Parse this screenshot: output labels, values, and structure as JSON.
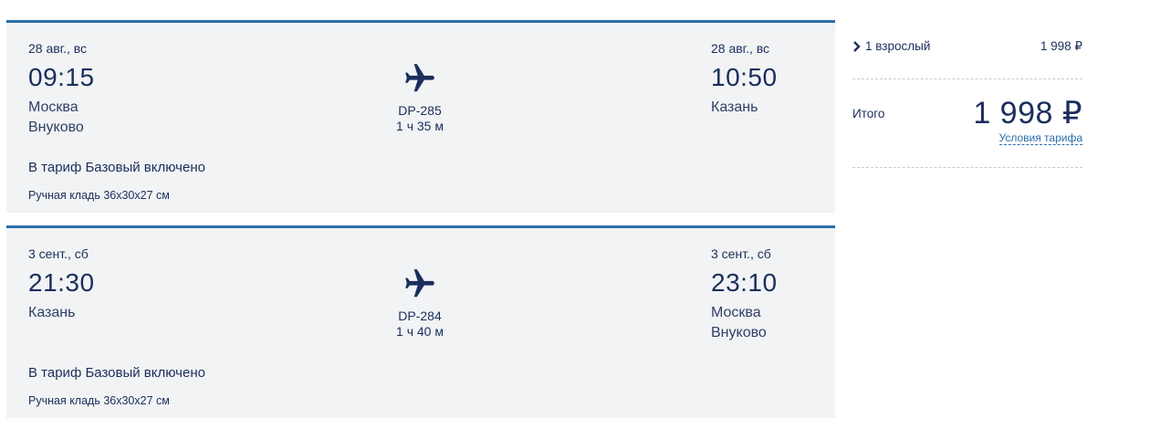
{
  "flights": [
    {
      "departure": {
        "date": "28 авг., вс",
        "time": "09:15",
        "city": "Москва",
        "airport": "Внуково"
      },
      "arrival": {
        "date": "28 авг., вс",
        "time": "10:50",
        "city": "Казань",
        "airport": ""
      },
      "flight_number": "DP-285",
      "duration": "1 ч 35 м",
      "fare_title": "В тариф Базовый включено",
      "baggage": "Ручная кладь 36x30x27 см"
    },
    {
      "departure": {
        "date": "3 сент., сб",
        "time": "21:30",
        "city": "Казань",
        "airport": ""
      },
      "arrival": {
        "date": "3 сент., сб",
        "time": "23:10",
        "city": "Москва",
        "airport": "Внуково"
      },
      "flight_number": "DP-284",
      "duration": "1 ч 40 м",
      "fare_title": "В тариф Базовый включено",
      "baggage": "Ручная кладь 36x30x27 см"
    }
  ],
  "summary": {
    "passengers_label": "1 взрослый",
    "passengers_price": "1 998 ₽",
    "total_label": "Итого",
    "total_price": "1 998 ₽",
    "tariff_link": "Условия тарифа"
  },
  "icons": {
    "plane": "plane-icon",
    "chevron": "chevron-right-icon"
  },
  "colors": {
    "accent": "#2b6fa8",
    "text": "#1b2e5c",
    "card_bg": "#f1f3f4"
  }
}
